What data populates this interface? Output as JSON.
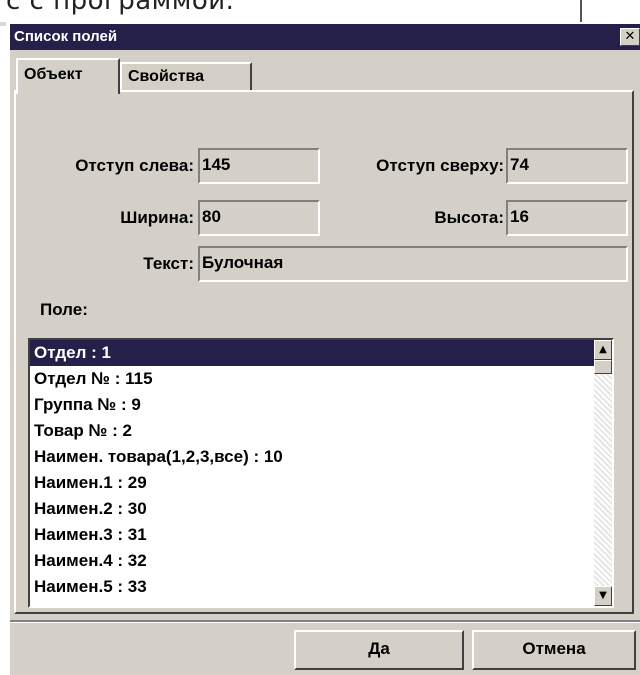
{
  "background": {
    "partial_text": "с с программой."
  },
  "dialog": {
    "title": "Список полей",
    "close_icon": "close-icon"
  },
  "tabs": [
    {
      "label": "Объект",
      "active": true
    },
    {
      "label": "Свойства",
      "active": false
    }
  ],
  "form": {
    "left_offset_label": "Отступ слева:",
    "left_offset_value": "145",
    "top_offset_label": "Отступ сверху:",
    "top_offset_value": "74",
    "width_label": "Ширина:",
    "width_value": "80",
    "height_label": "Высота:",
    "height_value": "16",
    "text_label": "Текст:",
    "text_value": "Булочная",
    "field_label": "Поле:"
  },
  "field_list": {
    "items": [
      "Отдел : 1",
      "Отдел № : 115",
      "Группа № : 9",
      "Товар № : 2",
      "Наимен. товара(1,2,3,все) : 10",
      "Наимен.1 : 29",
      "Наимен.2 : 30",
      "Наимен.3 : 31",
      "Наимен.4 : 32",
      "Наимен.5 : 33"
    ],
    "selected_index": 0
  },
  "buttons": {
    "ok_label": "Да",
    "cancel_label": "Отмена"
  },
  "colors": {
    "titlebar": "#24204a",
    "selection": "#24204a",
    "face": "#d4d0c8"
  }
}
